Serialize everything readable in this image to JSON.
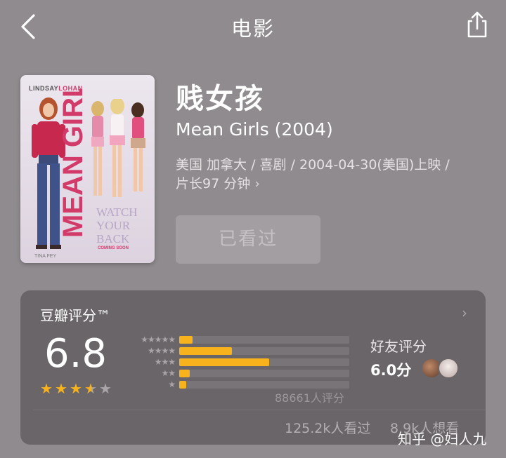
{
  "nav": {
    "title": "电影",
    "back_icon": "chevron-left-icon",
    "share_icon": "share-icon"
  },
  "poster": {
    "actor_first": "LINDSAY",
    "actor_last": "LOHAN",
    "title_text": "MEAN GIRLS",
    "tagline": [
      "WATCH",
      "YOUR",
      "BACK"
    ],
    "coming": "COMING SOON",
    "credit": "TINA FEY"
  },
  "movie": {
    "title": "贱女孩",
    "original_title": "Mean Girls (2004)",
    "meta_line1": "美国 加拿大 / 喜剧 / 2004-04-30(美国)上映 /",
    "meta_line2": "片长97 分钟",
    "meta_chevron": "›",
    "watched_button": "已看过"
  },
  "rating": {
    "label": "豆瓣评分™",
    "chevron": "›",
    "score": "6.8",
    "stars_value": 3.5,
    "stars_max": 5,
    "distribution": [
      {
        "stars": "★★★★★",
        "fraction": 0.08
      },
      {
        "stars": "★★★★",
        "fraction": 0.31
      },
      {
        "stars": "★★★",
        "fraction": 0.53
      },
      {
        "stars": "★★",
        "fraction": 0.06
      },
      {
        "stars": "★",
        "fraction": 0.04
      }
    ],
    "count": "88661人评分",
    "friend_label": "好友评分",
    "friend_score": "6.0分",
    "seen": "125.2k人看过",
    "want": "8.9k人想看"
  },
  "watermark": "知乎 @妇人九",
  "colors": {
    "background": "#8f8b8e",
    "card": "#696568",
    "star_accent": "#f7b21c",
    "brand_pink": "#d23a6a"
  }
}
